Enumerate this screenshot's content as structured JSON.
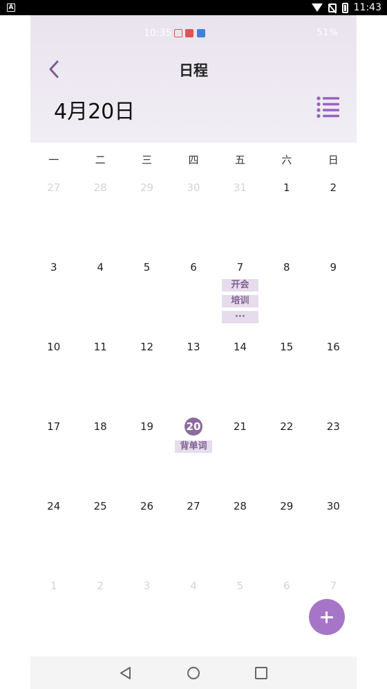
{
  "system_bar": {
    "time": "11:43",
    "app_icon": "A"
  },
  "inner_status": {
    "time": "10:35",
    "battery": "51%"
  },
  "header": {
    "title": "日程",
    "month_label": "4月20日"
  },
  "weekdays": [
    "一",
    "二",
    "三",
    "四",
    "五",
    "六",
    "日"
  ],
  "weeks": [
    [
      {
        "d": "27",
        "dim": true
      },
      {
        "d": "28",
        "dim": true
      },
      {
        "d": "29",
        "dim": true
      },
      {
        "d": "30",
        "dim": true
      },
      {
        "d": "31",
        "dim": true
      },
      {
        "d": "1"
      },
      {
        "d": "2"
      }
    ],
    [
      {
        "d": "3"
      },
      {
        "d": "4"
      },
      {
        "d": "5"
      },
      {
        "d": "6"
      },
      {
        "d": "7",
        "events": [
          "开会",
          "培训",
          "···"
        ]
      },
      {
        "d": "8"
      },
      {
        "d": "9"
      }
    ],
    [
      {
        "d": "10"
      },
      {
        "d": "11"
      },
      {
        "d": "12"
      },
      {
        "d": "13"
      },
      {
        "d": "14"
      },
      {
        "d": "15"
      },
      {
        "d": "16"
      }
    ],
    [
      {
        "d": "17"
      },
      {
        "d": "18"
      },
      {
        "d": "19"
      },
      {
        "d": "20",
        "today": true,
        "events": [
          "背单词"
        ]
      },
      {
        "d": "21"
      },
      {
        "d": "22"
      },
      {
        "d": "23"
      }
    ],
    [
      {
        "d": "24"
      },
      {
        "d": "25"
      },
      {
        "d": "26"
      },
      {
        "d": "27"
      },
      {
        "d": "28"
      },
      {
        "d": "29"
      },
      {
        "d": "30"
      }
    ],
    [
      {
        "d": "1",
        "dim": true
      },
      {
        "d": "2",
        "dim": true
      },
      {
        "d": "3",
        "dim": true
      },
      {
        "d": "4",
        "dim": true
      },
      {
        "d": "5",
        "dim": true
      },
      {
        "d": "6",
        "dim": true
      },
      {
        "d": "7",
        "dim": true
      }
    ]
  ],
  "colors": {
    "accent": "#8c6a9c",
    "fab": "#a775c8",
    "event_bg": "#e6dcec",
    "event_text": "#7e5f91"
  },
  "icons": {
    "back": "chevron-left-icon",
    "list": "list-icon",
    "add": "plus-icon"
  }
}
